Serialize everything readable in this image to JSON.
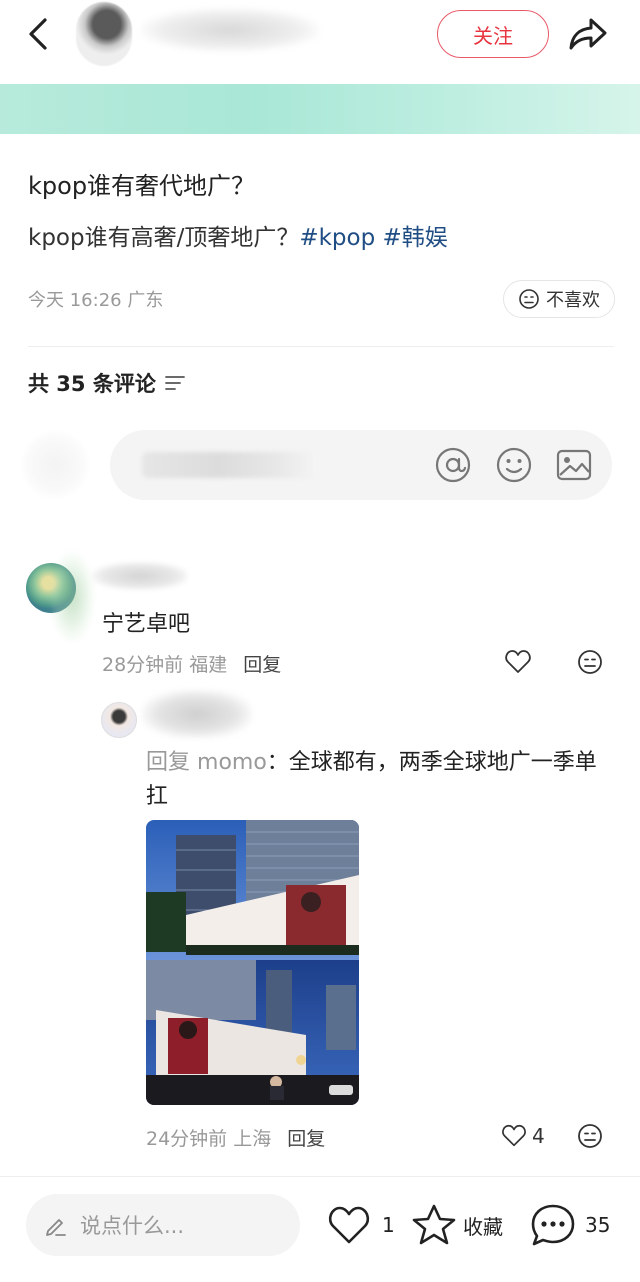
{
  "header": {
    "follow_label": "关注"
  },
  "post": {
    "title": "kpop谁有奢代地广？",
    "body_text": "kpop谁有高奢/顶奢地广？",
    "tags": [
      "#kpop",
      "#韩娱"
    ],
    "time": "今天 16:26",
    "location": "广东",
    "dislike_label": "不喜欢"
  },
  "comments_header": {
    "label": "共 35 条评论"
  },
  "comments": [
    {
      "text": "宁艺卓吧",
      "time": "28分钟前",
      "location": "福建",
      "reply_label": "回复",
      "replies": [
        {
          "prefix": "回复",
          "reply_to": "momo",
          "text": "：全球都有，两季全球地广一季单扛",
          "time": "24分钟前",
          "location": "上海",
          "reply_label": "回复",
          "likes": "4"
        }
      ]
    }
  ],
  "bottom_bar": {
    "input_placeholder": "说点什么...",
    "like_count": "1",
    "favorite_label": "收藏",
    "comment_count": "35"
  },
  "colors": {
    "accent_red": "#e8343f",
    "tag_blue": "#1f4d84",
    "banner_teal": "#b7eadb"
  }
}
